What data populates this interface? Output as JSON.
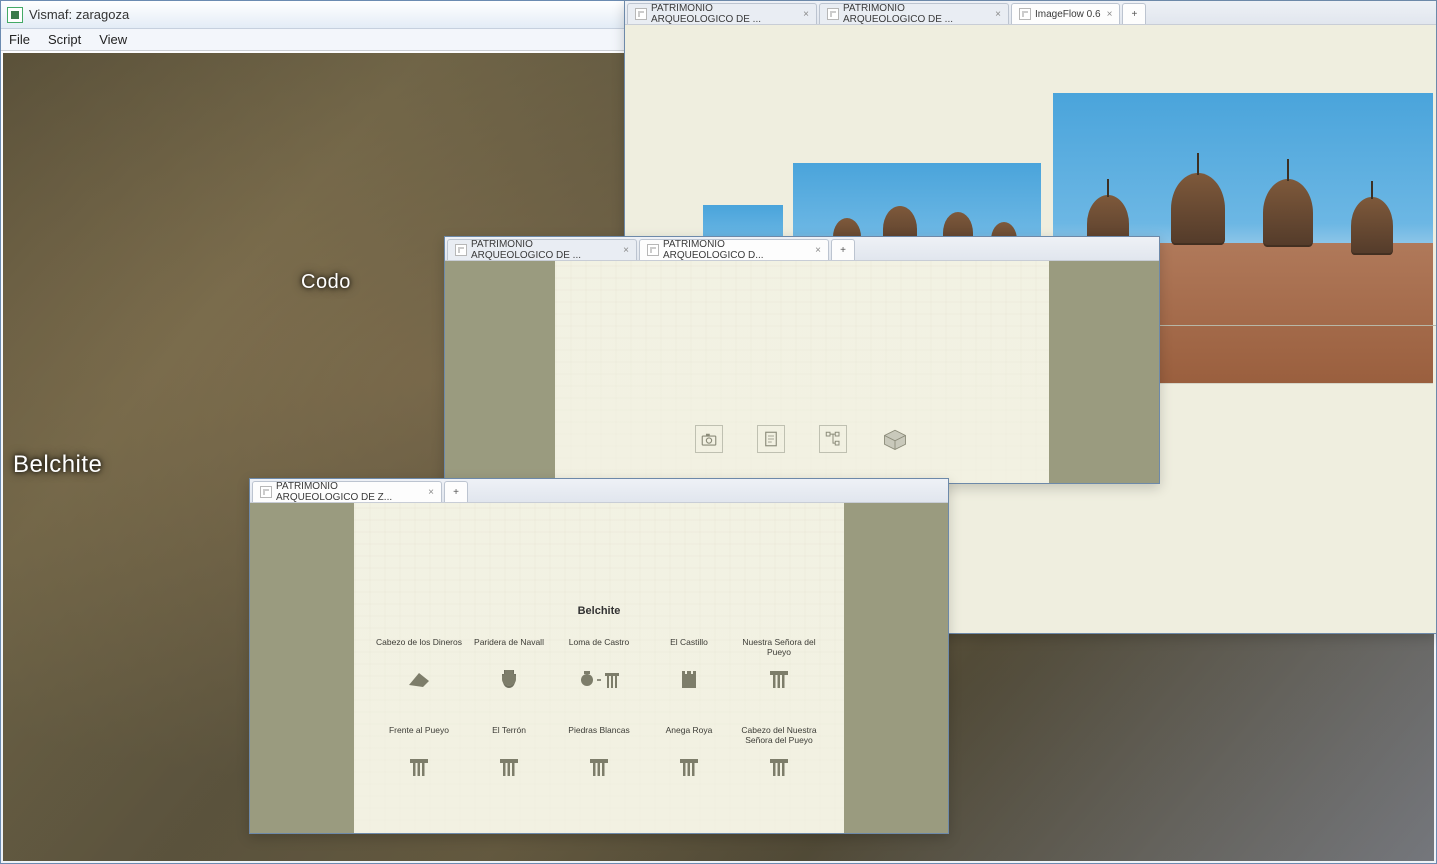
{
  "main_window": {
    "title": "Vismaf: zaragoza",
    "menu": {
      "file": "File",
      "script": "Script",
      "view": "View"
    },
    "map_labels": {
      "belchite": "Belchite",
      "codo": "Codo"
    }
  },
  "imageflow_window": {
    "tabs": [
      {
        "label": "PATRIMONIO ARQUEOLOGICO DE ..."
      },
      {
        "label": "PATRIMONIO ARQUEOLOGICO DE ..."
      },
      {
        "label": "ImageFlow 0.6"
      }
    ]
  },
  "patrimonio_upper": {
    "tabs": [
      {
        "label": "PATRIMONIO ARQUEOLOGICO DE ..."
      },
      {
        "label": "PATRIMONIO ARQUEOLOGICO D..."
      }
    ],
    "tools": [
      "camera-icon",
      "document-icon",
      "tree-icon",
      "model3d-icon"
    ]
  },
  "patrimonio_lower": {
    "tabs": [
      {
        "label": "PATRIMONIO ARQUEOLOGICO DE Z..."
      }
    ],
    "heading": "Belchite",
    "sites": [
      {
        "label": "Cabezo de los Dineros",
        "icon": "fragment-icon"
      },
      {
        "label": "Paridera de Navall",
        "icon": "urn-icon"
      },
      {
        "label": "Loma de Castro",
        "icon": "urn-column-icon"
      },
      {
        "label": "El Castillo",
        "icon": "tower-icon"
      },
      {
        "label": "Nuestra Señora del Pueyo",
        "icon": "column-icon"
      },
      {
        "label": "Frente al Pueyo",
        "icon": "column-icon"
      },
      {
        "label": "El Terrón",
        "icon": "column-icon"
      },
      {
        "label": "Piedras Blancas",
        "icon": "column-icon"
      },
      {
        "label": "Anega Roya",
        "icon": "column-icon"
      },
      {
        "label": "Cabezo del Nuestra Señora del Pueyo",
        "icon": "column-icon"
      }
    ]
  }
}
